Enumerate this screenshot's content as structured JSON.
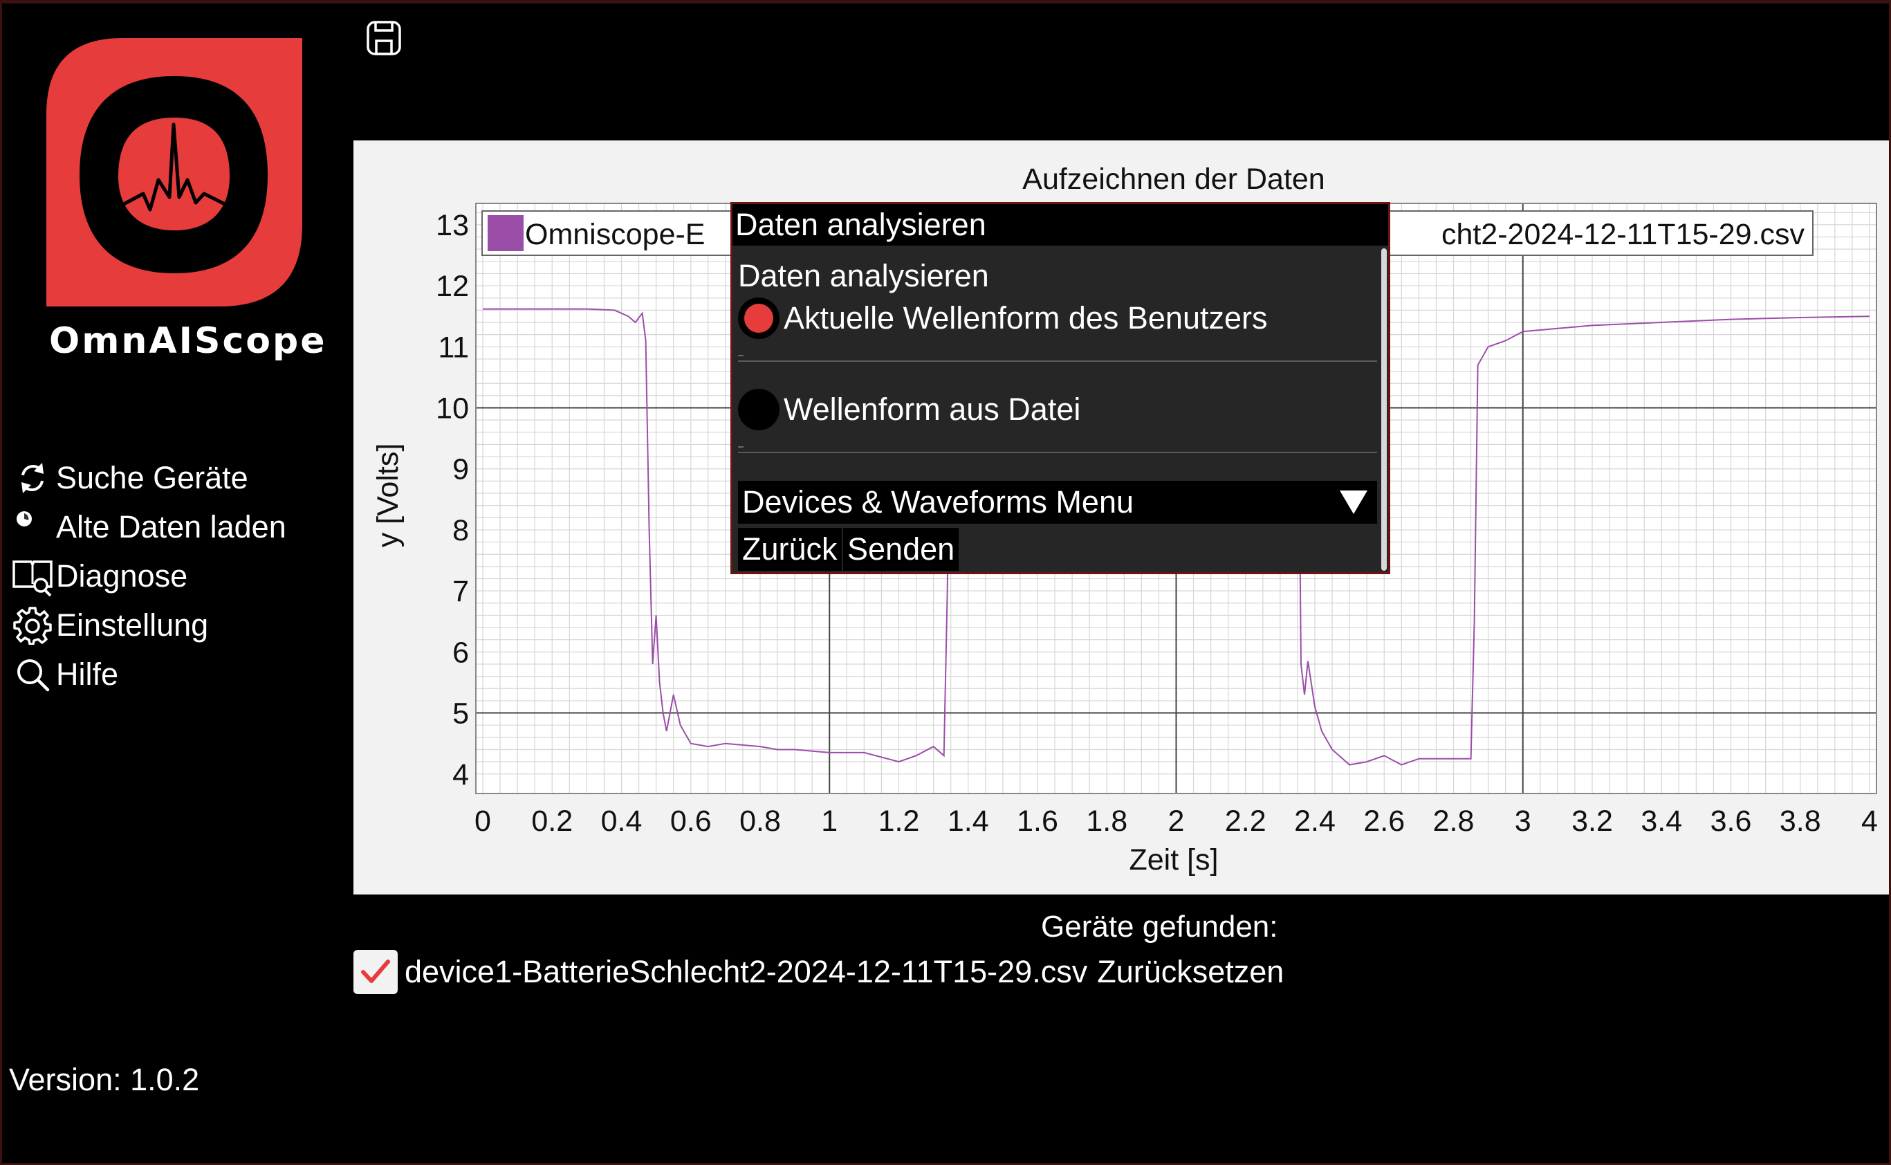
{
  "app": {
    "name": "OmnAIScope",
    "version": "Version: 1.0.2",
    "accent_color": "#e63c3c"
  },
  "sidebar": {
    "items": [
      {
        "label": "Suche Geräte",
        "icon": "refresh-icon"
      },
      {
        "label": "Alte Daten laden",
        "icon": "load-dot-icon"
      },
      {
        "label": "Diagnose",
        "icon": "book-search-icon"
      },
      {
        "label": "Einstellung",
        "icon": "gear-icon"
      },
      {
        "label": "Hilfe",
        "icon": "search-icon"
      }
    ]
  },
  "toolbar": {
    "save_icon": "save-icon"
  },
  "chart_data": {
    "type": "line",
    "title": "Aufzeichnen der Daten",
    "xlabel": "Zeit [s]",
    "ylabel": "y [Volts]",
    "xlim": [
      0,
      4
    ],
    "ylim": [
      4,
      13
    ],
    "xticks": [
      "0",
      "0.2",
      "0.4",
      "0.6",
      "0.8",
      "1",
      "1.2",
      "1.4",
      "1.6",
      "1.8",
      "2",
      "2.2",
      "2.4",
      "2.6",
      "2.8",
      "3",
      "3.2",
      "3.4",
      "3.6",
      "3.8",
      "4"
    ],
    "yticks": [
      "4",
      "5",
      "6",
      "7",
      "8",
      "9",
      "10",
      "11",
      "12",
      "13"
    ],
    "grid": true,
    "legend_position": "top",
    "legend_visible_left": "Omniscope-E",
    "legend_visible_right": "cht2-2024-12-11T15-29.csv",
    "series": [
      {
        "color": "#9b4ea8",
        "x": [
          0,
          0.1,
          0.2,
          0.3,
          0.38,
          0.42,
          0.44,
          0.46,
          0.47,
          0.48,
          0.49,
          0.5,
          0.51,
          0.52,
          0.53,
          0.55,
          0.57,
          0.6,
          0.65,
          0.7,
          0.8,
          0.85,
          0.9,
          1.0,
          1.05,
          1.1,
          1.2,
          1.25,
          1.3,
          1.33,
          1.34,
          1.35,
          2.35,
          2.36,
          2.37,
          2.38,
          2.4,
          2.42,
          2.45,
          2.5,
          2.55,
          2.6,
          2.65,
          2.7,
          2.8,
          2.85,
          2.86,
          2.87,
          2.9,
          2.95,
          3.0,
          3.1,
          3.2,
          3.4,
          3.6,
          3.8,
          4.0
        ],
        "y": [
          11.62,
          11.62,
          11.62,
          11.62,
          11.6,
          11.5,
          11.4,
          11.55,
          11.1,
          8.0,
          5.8,
          6.6,
          5.5,
          5.0,
          4.7,
          5.3,
          4.8,
          4.5,
          4.45,
          4.5,
          4.45,
          4.4,
          4.4,
          4.35,
          4.35,
          4.35,
          4.2,
          4.3,
          4.45,
          4.3,
          7.0,
          12.2,
          12.2,
          5.8,
          5.3,
          5.85,
          5.1,
          4.7,
          4.4,
          4.15,
          4.2,
          4.3,
          4.15,
          4.25,
          4.25,
          4.25,
          6.5,
          10.7,
          11.0,
          11.1,
          11.25,
          11.3,
          11.35,
          11.4,
          11.45,
          11.48,
          11.5
        ]
      }
    ]
  },
  "dialog": {
    "title": "Daten analysieren",
    "subtitle": "Daten analysieren",
    "options": [
      {
        "label": "Aktuelle Wellenform des Benutzers",
        "selected": true
      },
      {
        "label": "Wellenform aus Datei",
        "selected": false
      }
    ],
    "menu_label": "Devices & Waveforms Menu",
    "back_label": "Zurück",
    "send_label": "Senden"
  },
  "devices": {
    "title": "Geräte gefunden:",
    "file": "device1-BatterieSchlecht2-2024-12-11T15-29.csv",
    "checked": true,
    "reset_label": "Zurücksetzen"
  }
}
